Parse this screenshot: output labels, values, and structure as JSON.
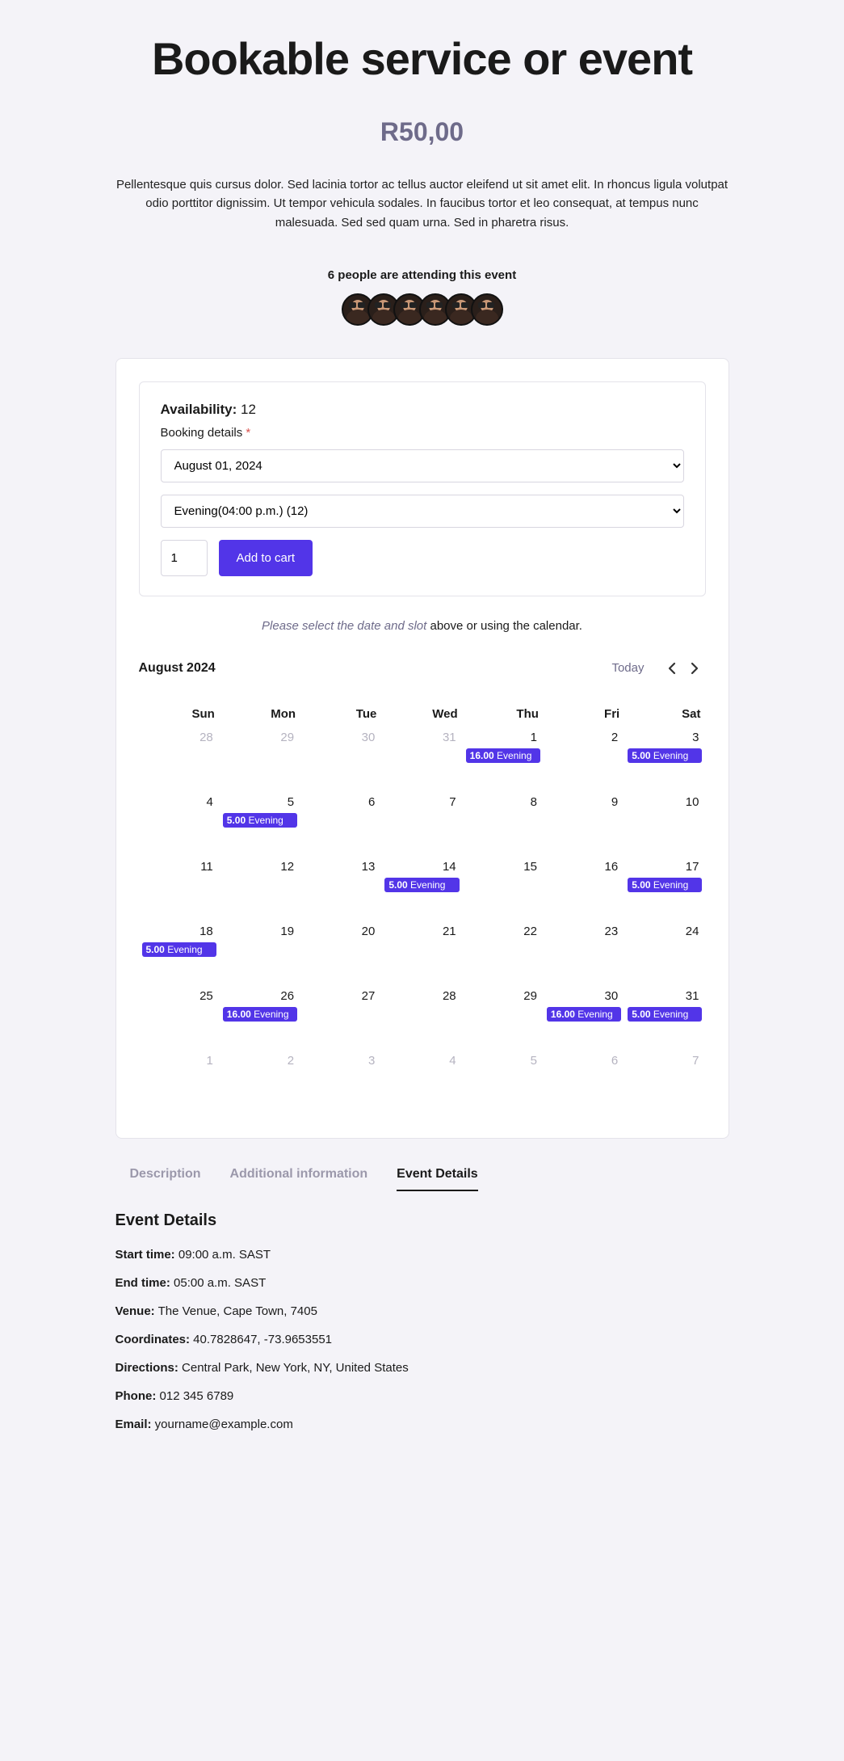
{
  "title": "Bookable service or event",
  "price": "R50,00",
  "descriptionText": "Pellentesque quis cursus dolor. Sed lacinia tortor ac tellus auctor eleifend ut sit amet elit. In rhoncus ligula volutpat odio porttitor dignissim. Ut tempor vehicula sodales. In faucibus tortor et leo consequat, at tempus nunc malesuada. Sed sed quam urna. Sed in pharetra risus.",
  "attendingLabel": "6 people are attending this event",
  "availabilityLabel": "Availability:",
  "availabilityValue": "12",
  "bookingDetailsLabel": "Booking details",
  "dateSelect": "August 01, 2024",
  "slotSelect": "Evening(04:00 p.m.) (12)",
  "qty": "1",
  "addToCart": "Add to cart",
  "helperItalic": "Please select the date and slot",
  "helperRest": " above or using the calendar.",
  "calendar": {
    "monthLabel": "August 2024",
    "todayLabel": "Today",
    "dow": [
      "Sun",
      "Mon",
      "Tue",
      "Wed",
      "Thu",
      "Fri",
      "Sat"
    ],
    "weeks": [
      [
        {
          "n": "28",
          "muted": true
        },
        {
          "n": "29",
          "muted": true
        },
        {
          "n": "30",
          "muted": true
        },
        {
          "n": "31",
          "muted": true
        },
        {
          "n": "1",
          "events": [
            {
              "count": "16.00",
              "label": "Evening"
            }
          ]
        },
        {
          "n": "2"
        },
        {
          "n": "3",
          "events": [
            {
              "count": "5.00",
              "label": "Evening"
            }
          ]
        }
      ],
      [
        {
          "n": "4"
        },
        {
          "n": "5",
          "events": [
            {
              "count": "5.00",
              "label": "Evening"
            }
          ]
        },
        {
          "n": "6"
        },
        {
          "n": "7"
        },
        {
          "n": "8"
        },
        {
          "n": "9"
        },
        {
          "n": "10"
        }
      ],
      [
        {
          "n": "11"
        },
        {
          "n": "12"
        },
        {
          "n": "13"
        },
        {
          "n": "14",
          "events": [
            {
              "count": "5.00",
              "label": "Evening"
            }
          ]
        },
        {
          "n": "15"
        },
        {
          "n": "16"
        },
        {
          "n": "17",
          "events": [
            {
              "count": "5.00",
              "label": "Evening"
            }
          ]
        }
      ],
      [
        {
          "n": "18",
          "events": [
            {
              "count": "5.00",
              "label": "Evening"
            }
          ]
        },
        {
          "n": "19"
        },
        {
          "n": "20"
        },
        {
          "n": "21"
        },
        {
          "n": "22"
        },
        {
          "n": "23"
        },
        {
          "n": "24"
        }
      ],
      [
        {
          "n": "25"
        },
        {
          "n": "26",
          "events": [
            {
              "count": "16.00",
              "label": "Evening"
            }
          ]
        },
        {
          "n": "27"
        },
        {
          "n": "28"
        },
        {
          "n": "29"
        },
        {
          "n": "30",
          "events": [
            {
              "count": "16.00",
              "label": "Evening"
            }
          ]
        },
        {
          "n": "31",
          "events": [
            {
              "count": "5.00",
              "label": "Evening"
            }
          ]
        }
      ],
      [
        {
          "n": "1",
          "muted": true
        },
        {
          "n": "2",
          "muted": true
        },
        {
          "n": "3",
          "muted": true
        },
        {
          "n": "4",
          "muted": true
        },
        {
          "n": "5",
          "muted": true
        },
        {
          "n": "6",
          "muted": true
        },
        {
          "n": "7",
          "muted": true
        }
      ]
    ]
  },
  "tabs": {
    "desc": "Description",
    "addl": "Additional information",
    "details": "Event Details"
  },
  "details": {
    "heading": "Event Details",
    "start_l": "Start time:",
    "start_v": " 09:00 a.m. SAST",
    "end_l": "End time:",
    "end_v": " 05:00 a.m. SAST",
    "venue_l": "Venue:",
    "venue_v": " The Venue, Cape Town, 7405",
    "coord_l": "Coordinates:",
    "coord_v": " 40.7828647, -73.9653551",
    "dir_l": "Directions:",
    "dir_v": " Central Park, New York, NY, United States",
    "phone_l": "Phone:",
    "phone_v": " 012 345 6789",
    "email_l": "Email:",
    "email_v": " yourname@example.com"
  }
}
